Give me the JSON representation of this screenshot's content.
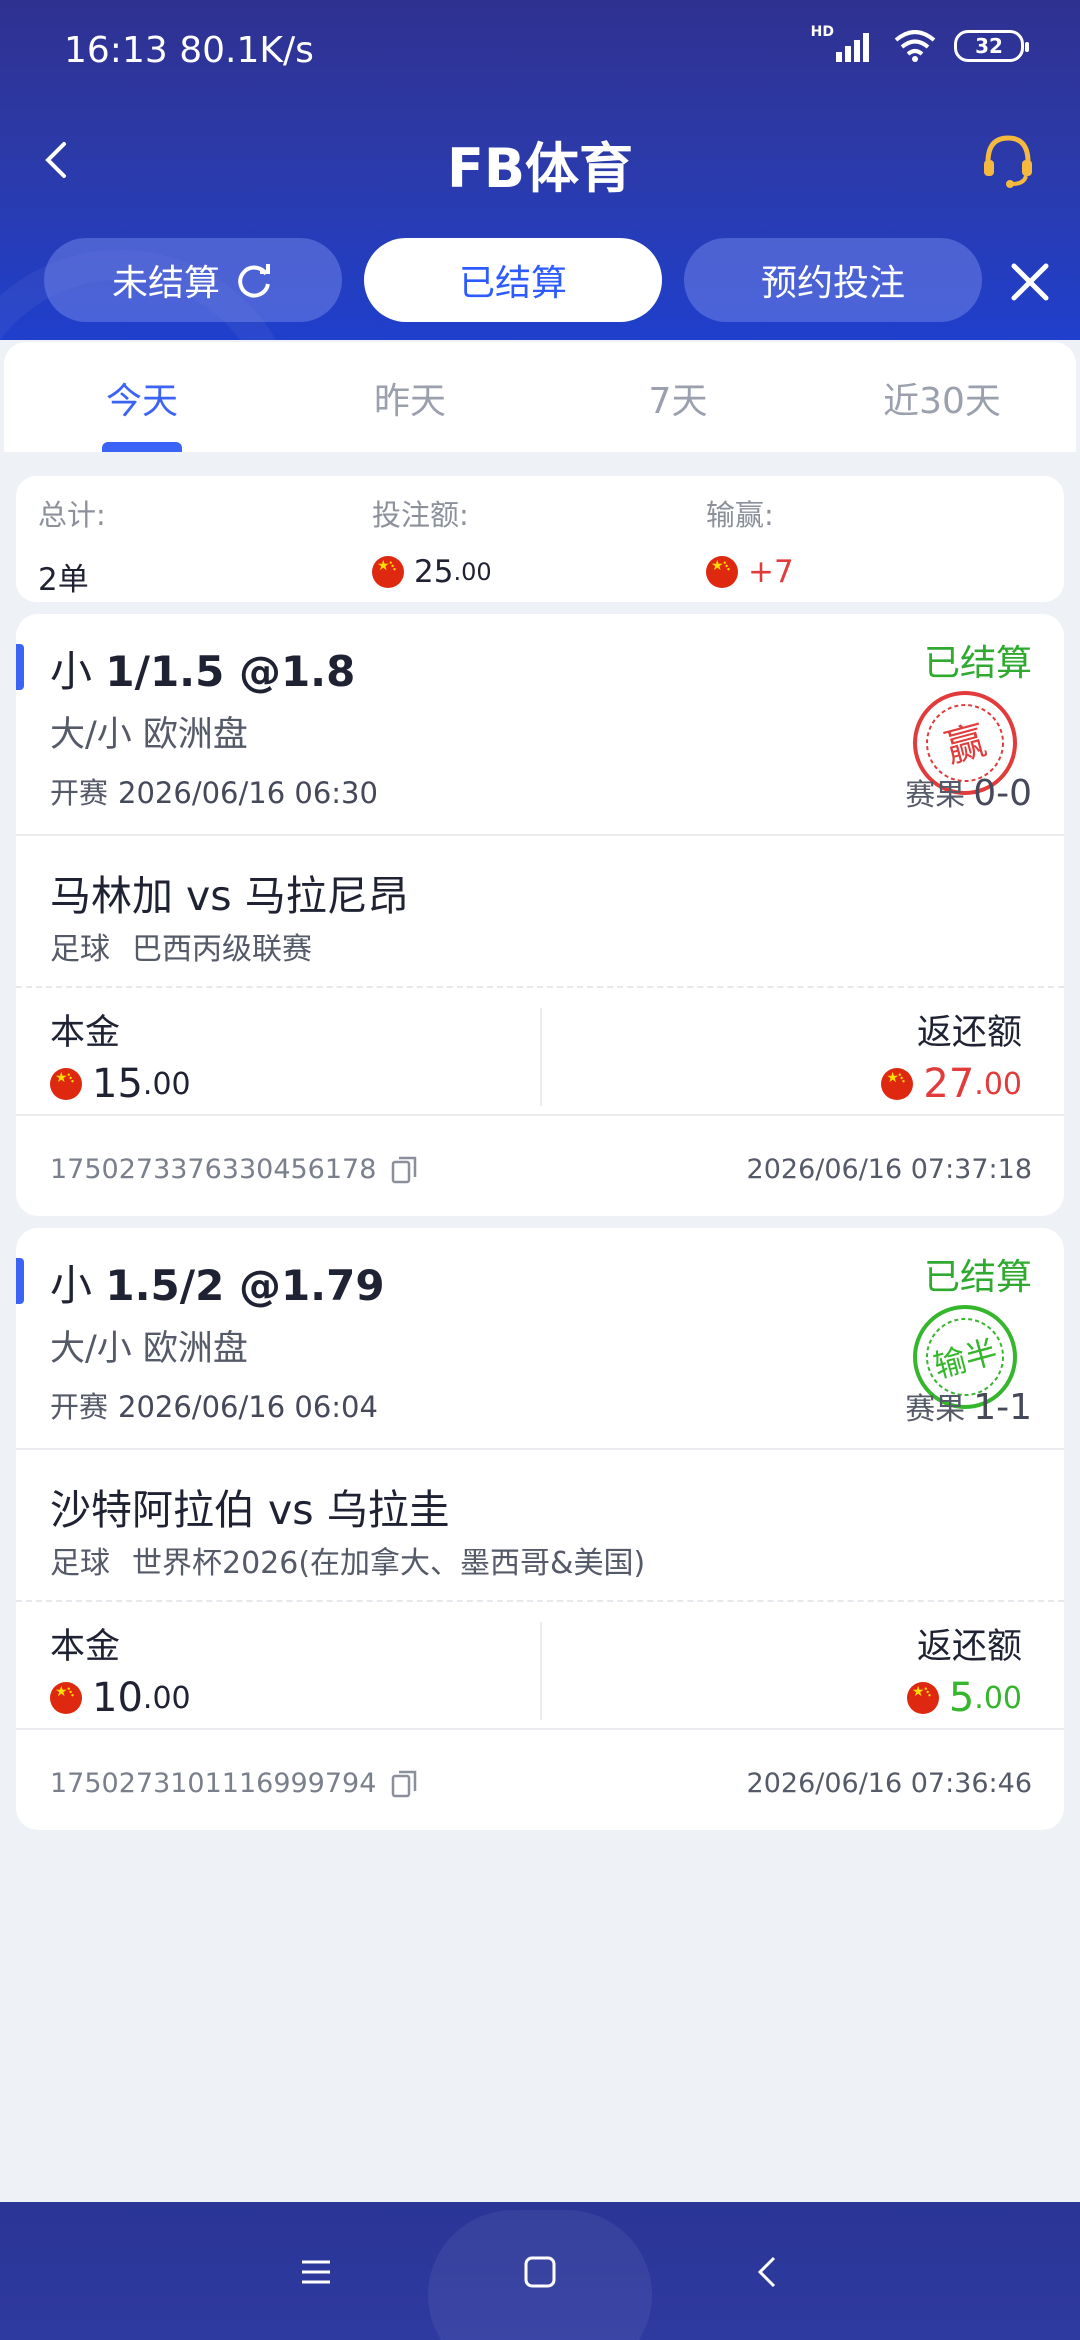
{
  "status_bar": {
    "time": "16:13",
    "speed": "80.1K/s",
    "hd": "HD",
    "battery": "32"
  },
  "header": {
    "title": "FB体育"
  },
  "top_tabs": [
    {
      "label": "未结算",
      "active": false
    },
    {
      "label": "已结算",
      "active": true
    },
    {
      "label": "预约投注",
      "active": false
    }
  ],
  "date_tabs": [
    {
      "label": "今天",
      "active": true
    },
    {
      "label": "昨天",
      "active": false
    },
    {
      "label": "7天",
      "active": false
    },
    {
      "label": "近30天",
      "active": false
    }
  ],
  "summary": {
    "total_label": "总计:",
    "total_value": "2单",
    "stake_label": "投注额:",
    "stake_int": "25",
    "stake_dec": ".00",
    "pnl_label": "输赢:",
    "pnl_value": "+7"
  },
  "bets": [
    {
      "selection_prefix": "小",
      "selection": "1/1.5 @1.8",
      "market": "大/小 欧洲盘",
      "kickoff_label": "开赛",
      "kickoff": "2026/06/16 06:30",
      "status": "已结算",
      "result_label": "赛果",
      "score": "0-0",
      "stamp_text": "赢",
      "stamp_color": "#e23b3b",
      "match": "马林加 vs 马拉尼昂",
      "sport": "足球",
      "league": "巴西丙级联赛",
      "principal_label": "本金",
      "principal_int": "15",
      "principal_dec": ".00",
      "return_label": "返还额",
      "return_int": "27",
      "return_dec": ".00",
      "order_id": "1750273376330456178",
      "time": "2026/06/16 07:37:18"
    },
    {
      "selection_prefix": "小",
      "selection": "1.5/2 @1.79",
      "market": "大/小 欧洲盘",
      "kickoff_label": "开赛",
      "kickoff": "2026/06/16 06:04",
      "status": "已结算",
      "result_label": "赛果",
      "score": "1-1",
      "stamp_text": "输半",
      "stamp_color": "#35b62d",
      "match": "沙特阿拉伯 vs 乌拉圭",
      "sport": "足球",
      "league": "世界杯2026(在加拿大、墨西哥&美国)",
      "principal_label": "本金",
      "principal_int": "10",
      "principal_dec": ".00",
      "return_label": "返还额",
      "return_int": "5",
      "return_dec": ".00",
      "order_id": "1750273101116999794",
      "time": "2026/06/16 07:36:46"
    }
  ],
  "colors": {
    "primary": "#3b63f5",
    "win": "#e23b3b",
    "loss": "#35b62d",
    "header": "#2c3aa8"
  }
}
